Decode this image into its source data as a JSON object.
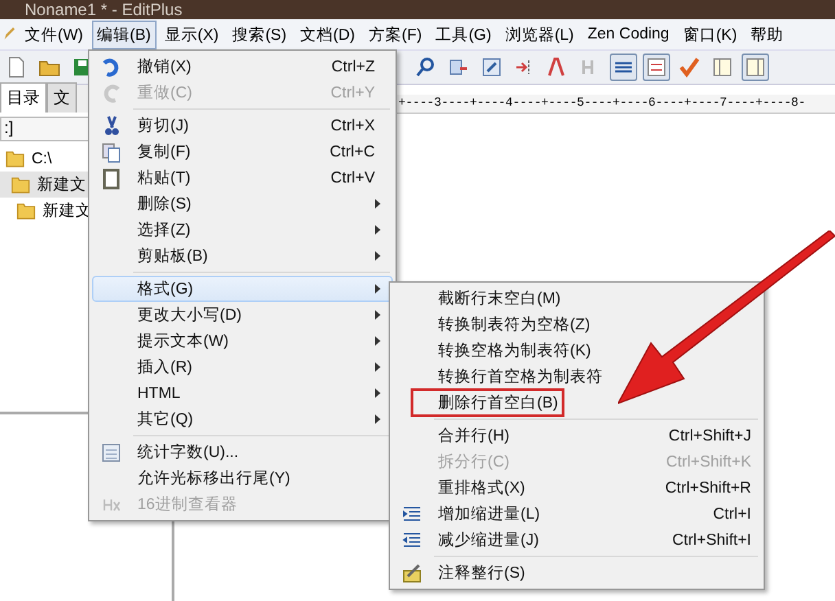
{
  "window": {
    "title": "Noname1 * - EditPlus"
  },
  "menubar": [
    {
      "label": "文件(W)",
      "selected": false
    },
    {
      "label": "编辑(B)",
      "selected": true
    },
    {
      "label": "显示(X)",
      "selected": false
    },
    {
      "label": "搜索(S)",
      "selected": false
    },
    {
      "label": "文档(D)",
      "selected": false
    },
    {
      "label": "方案(F)",
      "selected": false
    },
    {
      "label": "工具(G)",
      "selected": false
    },
    {
      "label": "浏览器(L)",
      "selected": false
    },
    {
      "label": "Zen Coding",
      "selected": false
    },
    {
      "label": "窗口(K)",
      "selected": false
    },
    {
      "label": "帮助",
      "selected": false
    }
  ],
  "toolbar": [
    {
      "pressed": false
    },
    {
      "pressed": false
    },
    {
      "pressed": false
    },
    {
      "pressed": false
    },
    {
      "pressed": false
    },
    {
      "pressed": false
    },
    {
      "pressed": false
    },
    {
      "pressed": false
    },
    {
      "pressed": false
    },
    {
      "pressed": true
    },
    {
      "pressed": true
    },
    {
      "pressed": false
    },
    {
      "pressed": false
    },
    {
      "pressed": true
    }
  ],
  "left_panel": {
    "tabs": [
      {
        "label": "目录",
        "selected": true
      },
      {
        "label": "文",
        "selected": false
      }
    ],
    "drive": ":]",
    "tree": [
      {
        "label": "C:\\",
        "selected": false,
        "children": [
          {
            "label": "新建文",
            "selected": true,
            "children": [
              {
                "label": "新建文",
                "selected": false
              }
            ]
          }
        ]
      }
    ]
  },
  "editor": {
    "ruler": "+----3----+----4----+----5----+----6----+----7----+----8-"
  },
  "edit_menu": [
    {
      "kind": "item",
      "label": "撤销(X)",
      "shortcut": "Ctrl+Z",
      "disabled": false,
      "selected": false,
      "submenu": false
    },
    {
      "kind": "item",
      "label": "重做(C)",
      "shortcut": "Ctrl+Y",
      "disabled": true,
      "selected": false,
      "submenu": false
    },
    {
      "kind": "separator"
    },
    {
      "kind": "item",
      "label": "剪切(J)",
      "shortcut": "Ctrl+X",
      "disabled": false,
      "selected": false,
      "submenu": false
    },
    {
      "kind": "item",
      "label": "复制(F)",
      "shortcut": "Ctrl+C",
      "disabled": false,
      "selected": false,
      "submenu": false
    },
    {
      "kind": "item",
      "label": "粘贴(T)",
      "shortcut": "Ctrl+V",
      "disabled": false,
      "selected": false,
      "submenu": false
    },
    {
      "kind": "item",
      "label": "删除(S)",
      "disabled": false,
      "selected": false,
      "submenu": true
    },
    {
      "kind": "item",
      "label": "选择(Z)",
      "disabled": false,
      "selected": false,
      "submenu": true
    },
    {
      "kind": "item",
      "label": "剪贴板(B)",
      "disabled": false,
      "selected": false,
      "submenu": true
    },
    {
      "kind": "separator"
    },
    {
      "kind": "item",
      "label": "格式(G)",
      "disabled": false,
      "selected": true,
      "submenu": true
    },
    {
      "kind": "item",
      "label": "更改大小写(D)",
      "disabled": false,
      "selected": false,
      "submenu": true
    },
    {
      "kind": "item",
      "label": "提示文本(W)",
      "disabled": false,
      "selected": false,
      "submenu": true
    },
    {
      "kind": "item",
      "label": "插入(R)",
      "disabled": false,
      "selected": false,
      "submenu": true
    },
    {
      "kind": "item",
      "label": "HTML",
      "disabled": false,
      "selected": false,
      "submenu": true
    },
    {
      "kind": "item",
      "label": "其它(Q)",
      "disabled": false,
      "selected": false,
      "submenu": true
    },
    {
      "kind": "separator"
    },
    {
      "kind": "item",
      "label": "统计字数(U)...",
      "disabled": false,
      "selected": false,
      "submenu": false
    },
    {
      "kind": "item",
      "label": "允许光标移出行尾(Y)",
      "disabled": false,
      "selected": false,
      "submenu": false
    },
    {
      "kind": "item",
      "label": "16进制查看器",
      "disabled": true,
      "selected": false,
      "submenu": false
    }
  ],
  "format_submenu": [
    {
      "kind": "item",
      "label": "截断行末空白(M)",
      "disabled": false,
      "marked": false
    },
    {
      "kind": "item",
      "label": "转换制表符为空格(Z)",
      "disabled": false,
      "marked": false
    },
    {
      "kind": "item",
      "label": "转换空格为制表符(K)",
      "disabled": false,
      "marked": false
    },
    {
      "kind": "item",
      "label": "转换行首空格为制表符",
      "disabled": false,
      "marked": false
    },
    {
      "kind": "item",
      "label": "删除行首空白(B)",
      "disabled": false,
      "marked": true
    },
    {
      "kind": "separator"
    },
    {
      "kind": "item",
      "label": "合并行(H)",
      "shortcut": "Ctrl+Shift+J",
      "disabled": false,
      "marked": false
    },
    {
      "kind": "item",
      "label": "拆分行(C)",
      "shortcut": "Ctrl+Shift+K",
      "disabled": true,
      "marked": false
    },
    {
      "kind": "item",
      "label": "重排格式(X)",
      "shortcut": "Ctrl+Shift+R",
      "disabled": false,
      "marked": false
    },
    {
      "kind": "item",
      "label": "增加缩进量(L)",
      "shortcut": "Ctrl+I",
      "disabled": false,
      "marked": false
    },
    {
      "kind": "item",
      "label": "减少缩进量(J)",
      "shortcut": "Ctrl+Shift+I",
      "disabled": false,
      "marked": false
    },
    {
      "kind": "separator"
    },
    {
      "kind": "item",
      "label": "注释整行(S)",
      "disabled": false,
      "marked": false
    }
  ]
}
